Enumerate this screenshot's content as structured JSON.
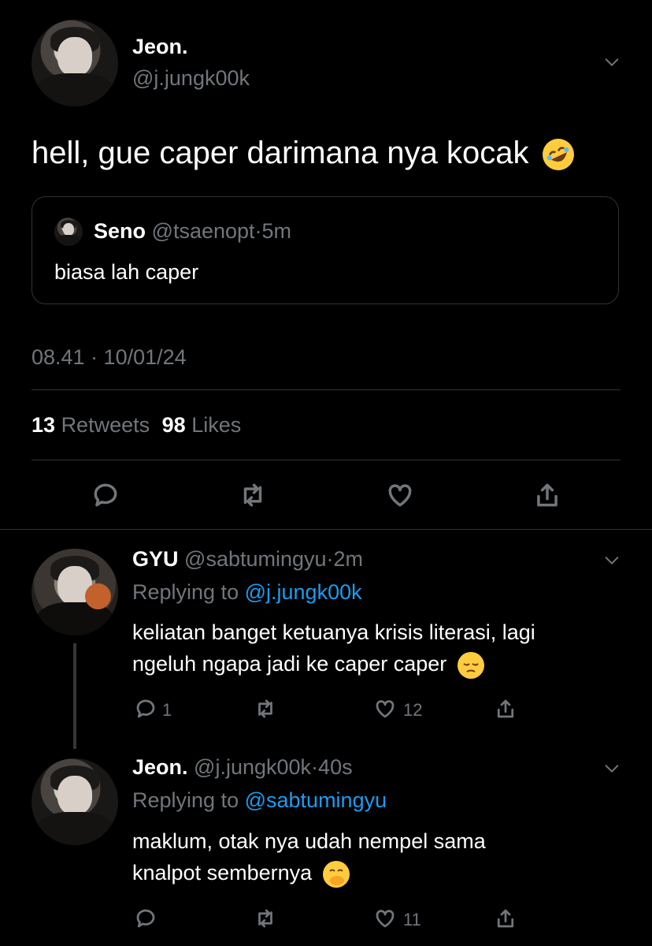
{
  "main_tweet": {
    "display_name": "Jeon.",
    "handle": "@j.jungk00k",
    "text": "hell, gue caper darimana nya kocak",
    "emoji": "rolling-on-floor-laughing",
    "quote": {
      "name": "Seno",
      "handle": "@tsaenopt",
      "time": "5m",
      "separator": "·",
      "text": "biasa lah caper"
    },
    "timestamp": "08.41 · 10/01/24",
    "retweets_count": "13",
    "retweets_label": "Retweets",
    "likes_count": "98",
    "likes_label": "Likes"
  },
  "replies": [
    {
      "name": "GYU",
      "handle": "@sabtumingyu",
      "separator": "·",
      "time": "2m",
      "replying_to_label": "Replying to",
      "replying_to": "@j.jungk00k",
      "line1": "keliatan banget ketuanya krisis literasi, lagi",
      "line2": "ngeluh ngapa jadi ke caper caper",
      "emoji": "pensive",
      "reply_count": "1",
      "like_count": "12"
    },
    {
      "name": "Jeon.",
      "handle": "@j.jungk00k",
      "separator": "·",
      "time": "40s",
      "replying_to_label": "Replying to",
      "replying_to": "@sabtumingyu",
      "line1": "maklum, otak nya udah nempel sama",
      "line2": "knalpot sembernya",
      "emoji": "face-with-hand-over-mouth",
      "reply_count": "",
      "like_count": "11"
    }
  ],
  "colors": {
    "link": "#1d9bf0",
    "muted": "#71767b",
    "text": "#e7e9ea",
    "background": "#000000"
  }
}
